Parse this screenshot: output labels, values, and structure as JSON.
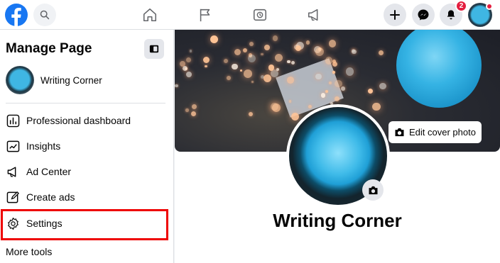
{
  "topbar": {
    "notifications_badge": "2",
    "icons": [
      "facebook-logo",
      "search-icon",
      "home-icon",
      "flag-icon",
      "watch-icon",
      "megaphone-icon",
      "plus-icon",
      "messenger-icon",
      "bell-icon",
      "account-avatar"
    ]
  },
  "sidebar": {
    "title": "Manage Page",
    "page_name": "Writing Corner",
    "items": [
      {
        "label": "Professional dashboard",
        "icon": "dashboard-icon"
      },
      {
        "label": "Insights",
        "icon": "insights-icon"
      },
      {
        "label": "Ad Center",
        "icon": "megaphone-icon"
      },
      {
        "label": "Create ads",
        "icon": "pencil-icon"
      },
      {
        "label": "Settings",
        "icon": "gear-icon"
      }
    ],
    "more_tools": "More tools"
  },
  "main": {
    "edit_cover_label": "Edit cover photo",
    "page_title": "Writing Corner"
  },
  "colors": {
    "brand": "#1877f2",
    "highlight": "#e00000",
    "badge": "#e41e3f"
  }
}
